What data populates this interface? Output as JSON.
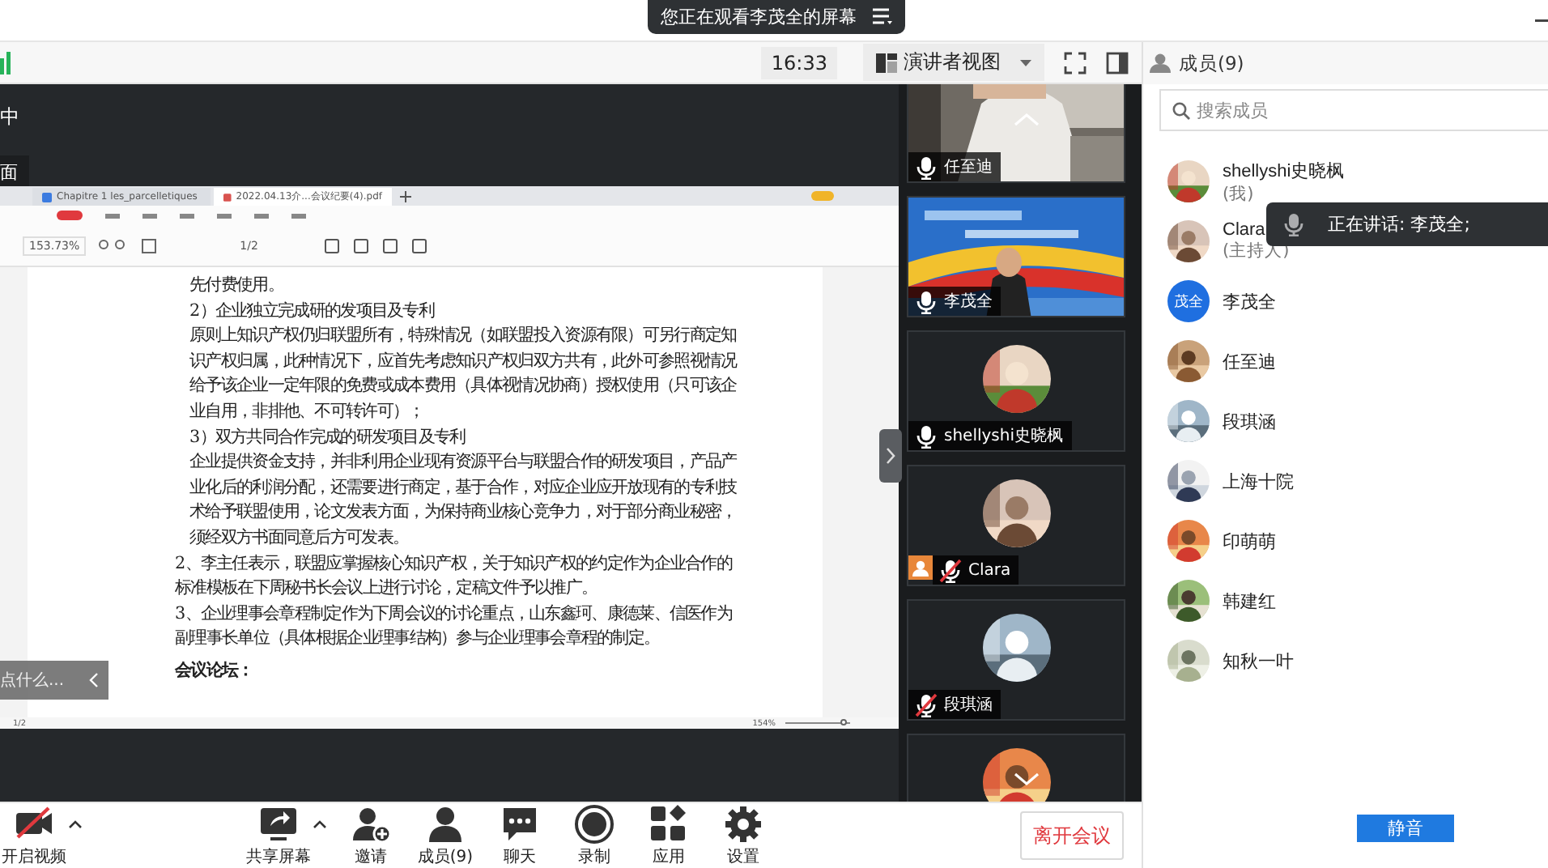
{
  "banner": {
    "text": "您正在观看李茂全的屏幕"
  },
  "toolbar": {
    "time": "16:33",
    "view_label": "演讲者视图"
  },
  "shared_screen": {
    "cut_texts": [
      "中",
      "面"
    ],
    "tabs": [
      {
        "label": "Chapitre 1 les_parcelletiques",
        "selected": false
      },
      {
        "label": "2022.04.13介...会议纪要(4).pdf",
        "selected": true
      }
    ],
    "zoom": "153.73%",
    "page": "1/2",
    "paragraphs": [
      {
        "kind": "indent",
        "text": "先付费使用。"
      },
      {
        "kind": "indent",
        "text": "2）企业独立完成研的发项目及专利"
      },
      {
        "kind": "indent",
        "text": "原则上知识产权仍归联盟所有，特殊情况（如联盟投入资源有限）可另行商定知识产权归属，此种情况下，应首先考虑知识产权归双方共有，此外可参照视情况给予该企业一定年限的免费或成本费用（具体视情况协商）授权使用（只可该企业自用，非排他、不可转许可）；"
      },
      {
        "kind": "indent",
        "text": "3）双方共同合作完成的研发项目及专利"
      },
      {
        "kind": "indent",
        "text": "企业提供资金支持，并非利用企业现有资源平台与联盟合作的研发项目，产品产业化后的利润分配，还需要进行商定，基于合作，对应企业应开放现有的专利技术给予联盟使用，论文发表方面，为保持商业核心竞争力，对于部分商业秘密，须经双方书面同意后方可发表。"
      },
      {
        "kind": "item",
        "text": "2、李主任表示，联盟应掌握核心知识产权，关于知识产权的约定作为企业合作的标准模板在下周秘书长会议上进行讨论，定稿文件予以推广。"
      },
      {
        "kind": "item",
        "text": "3、企业理事会章程制定作为下周会议的讨论重点，山东鑫珂、康德莱、信医作为副理事长单位（具体根据企业理事结构）参与企业理事会章程的制定。"
      },
      {
        "kind": "heading",
        "text": "会议论坛："
      }
    ],
    "status_page": "1/2",
    "status_zoom": "154%",
    "zoom_slider": {
      "level": 0.9
    },
    "hint": "点什么..."
  },
  "videos": [
    {
      "kind": "video",
      "name": "任至迪",
      "muted": false,
      "host": false
    },
    {
      "kind": "video",
      "name": "李茂全",
      "muted": false,
      "host": false
    },
    {
      "kind": "avatar",
      "name": "shellyshi史晓枫",
      "muted": false,
      "host": false
    },
    {
      "kind": "avatar",
      "name": "Clara",
      "muted": true,
      "host": true
    },
    {
      "kind": "avatar",
      "name": "段琪涵",
      "muted": true,
      "host": false
    },
    {
      "kind": "avatar"
    }
  ],
  "members": {
    "title": "成员(9)",
    "search_placeholder": "搜索成员",
    "items": [
      {
        "name": "shellyshi史晓枫",
        "note": "(我)",
        "kind": "picture"
      },
      {
        "name": "Clara",
        "note": "(主持人)",
        "kind": "picture"
      },
      {
        "name": "李茂全",
        "kind": "initials",
        "initials": "茂全"
      },
      {
        "name": "任至迪",
        "kind": "picture"
      },
      {
        "name": "段琪涵",
        "kind": "picture"
      },
      {
        "name": "上海十院",
        "kind": "picture"
      },
      {
        "name": "印萌萌",
        "kind": "picture"
      },
      {
        "name": "韩建红",
        "kind": "picture"
      },
      {
        "name": "知秋一叶",
        "kind": "picture"
      }
    ]
  },
  "speaking_toast": "正在讲话: 李茂全;",
  "bottom_bar": {
    "buttons": [
      {
        "label": "开启视频",
        "caret": true
      },
      {
        "label": "共享屏幕",
        "caret": true
      },
      {
        "label": "邀请",
        "caret": false
      },
      {
        "label": "成员(9)",
        "caret": false
      },
      {
        "label": "聊天",
        "caret": false
      },
      {
        "label": "录制",
        "caret": false
      },
      {
        "label": "应用",
        "caret": false
      },
      {
        "label": "设置",
        "caret": false
      }
    ],
    "leave": "离开会议"
  },
  "mute_button": "静音"
}
